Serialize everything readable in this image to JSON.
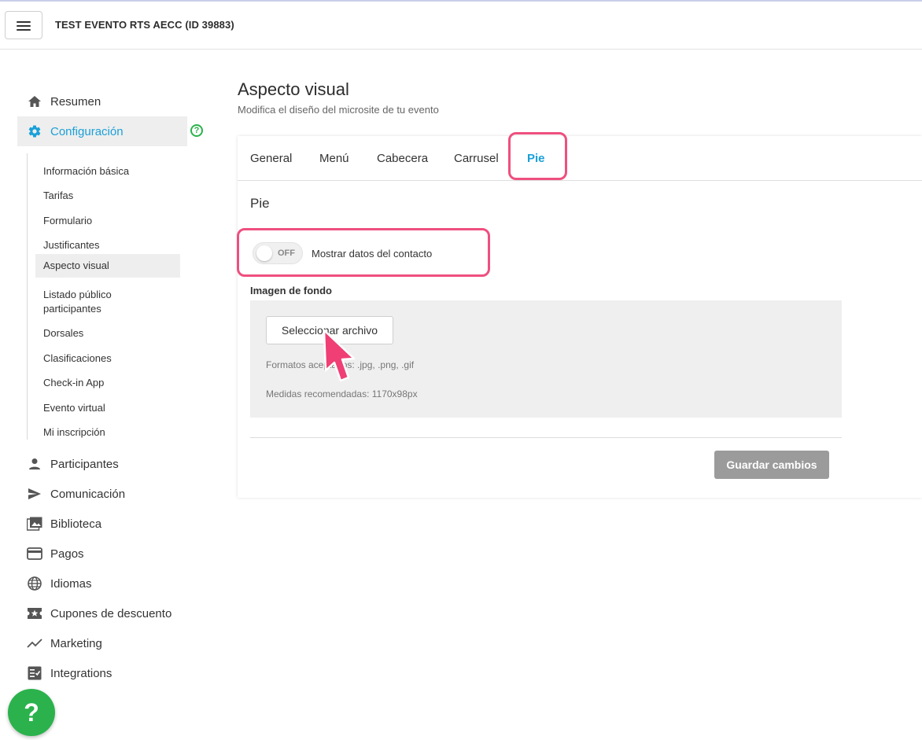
{
  "header": {
    "event_title": "TEST EVENTO RTS AECC (ID 39883)"
  },
  "sidebar": {
    "main_items_top": [
      {
        "label": "Resumen",
        "icon": "home-icon"
      },
      {
        "label": "Configuración",
        "icon": "gear-icon",
        "active": true
      }
    ],
    "sub_items": [
      {
        "label": "Información básica"
      },
      {
        "label": "Tarifas"
      },
      {
        "label": "Formulario"
      },
      {
        "label": "Justificantes"
      },
      {
        "label": "Aspecto visual",
        "active": true
      },
      {
        "label": "Listado público participantes"
      },
      {
        "label": "Dorsales"
      },
      {
        "label": "Clasificaciones"
      },
      {
        "label": "Check-in App"
      },
      {
        "label": "Evento virtual"
      },
      {
        "label": "Mi inscripción"
      }
    ],
    "main_items_bottom": [
      {
        "label": "Participantes",
        "icon": "person-icon"
      },
      {
        "label": "Comunicación",
        "icon": "send-icon"
      },
      {
        "label": "Biblioteca",
        "icon": "library-icon"
      },
      {
        "label": "Pagos",
        "icon": "card-icon"
      },
      {
        "label": "Idiomas",
        "icon": "globe-icon"
      },
      {
        "label": "Cupones de descuento",
        "icon": "coupon-icon"
      },
      {
        "label": "Marketing",
        "icon": "trend-icon"
      },
      {
        "label": "Integrations",
        "icon": "checklist-icon"
      }
    ]
  },
  "page": {
    "title": "Aspecto visual",
    "subtitle": "Modifica el diseño del microsite de tu evento"
  },
  "tabs": [
    {
      "label": "General"
    },
    {
      "label": "Menú"
    },
    {
      "label": "Cabecera"
    },
    {
      "label": "Carrusel"
    },
    {
      "label": "Pie",
      "active": true
    }
  ],
  "section": {
    "title": "Pie",
    "toggle_state": "OFF",
    "toggle_label": "Mostrar datos del contacto",
    "bg_label": "Imagen de fondo",
    "file_button": "Seleccionar archivo",
    "formats": "Formatos aceptados: .jpg, .png, .gif",
    "sizes": "Medidas recomendadas: 1170x98px",
    "save_button": "Guardar cambios"
  },
  "help_button": "?",
  "colors": {
    "accent": "#1aa0d8",
    "highlight": "#ef4f7f",
    "help_green": "#2bb24c",
    "save_disabled": "#9b9b9b"
  }
}
